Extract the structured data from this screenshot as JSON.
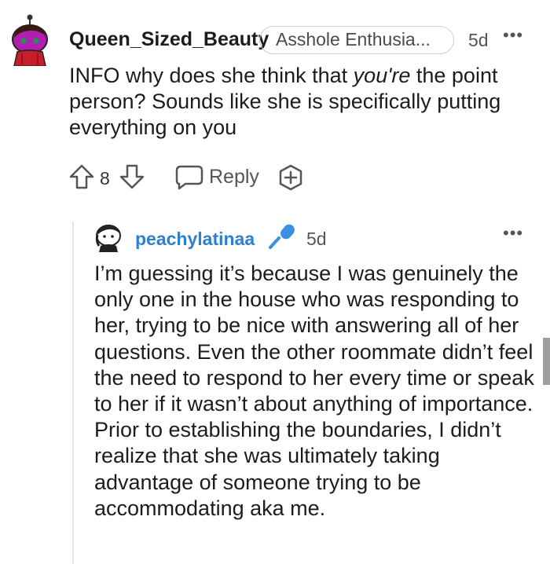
{
  "comment": {
    "username": "Queen_Sized_Beauty",
    "flair": "Asshole Enthusia...",
    "time": "5d",
    "more": "•••",
    "body_before": "INFO why does she think that ",
    "body_em": "you're",
    "body_after": " the point person? Sounds like she is specifically putting everything on you",
    "votes": "8",
    "reply_label": "Reply"
  },
  "reply": {
    "username": "peachylatinaa",
    "time": "5d",
    "more": "•••",
    "body": "I’m guessing it’s because I was genuinely the only one in the house who was responding to her, trying to be nice with answering all of her questions. Even the other roommate didn’t feel the need to respond to her every time or speak to her if it wasn’t about anything of importance. Prior to establishing the boundaries, I didn’t realize that she was ultimately taking advantage of someone trying to be accommodating aka me."
  },
  "icons": {
    "upvote": "arrow-up-outline",
    "downvote": "arrow-down-outline",
    "reply": "speech-bubble",
    "award": "plus-award",
    "mod": "microphone",
    "more": "ellipsis"
  },
  "colors": {
    "reply_username": "#2d7fcf",
    "mod_icon": "#3d8fe0",
    "avatar1_bg": "#7a1a7a"
  }
}
